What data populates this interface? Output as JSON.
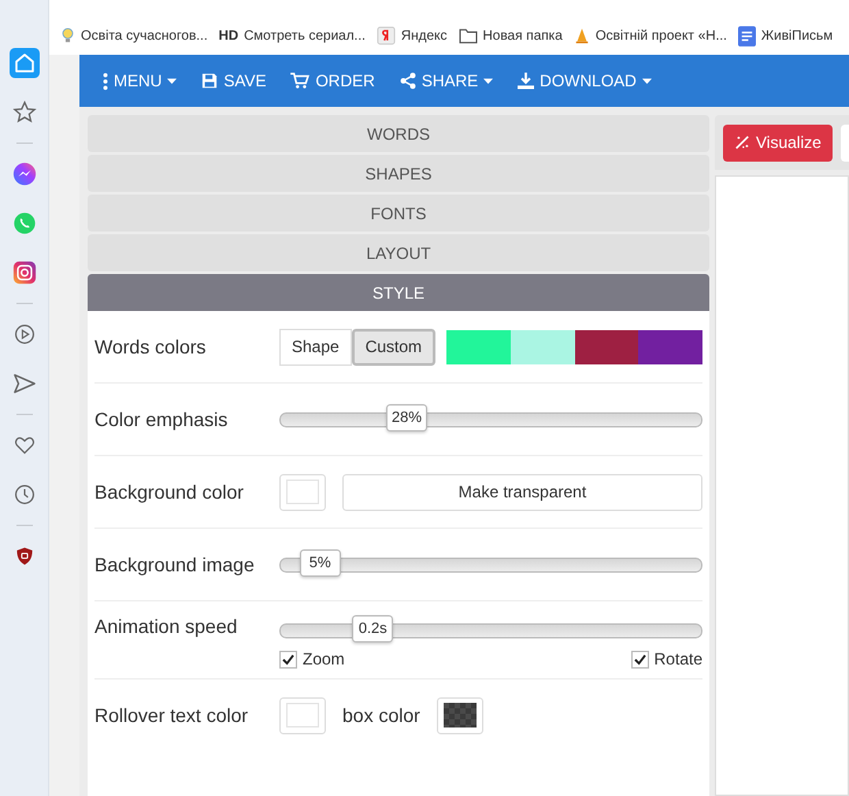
{
  "browser_sidebar": {
    "items": [
      {
        "kind": "home",
        "selected": true
      },
      {
        "kind": "star",
        "selected": false
      },
      {
        "kind": "messenger",
        "selected": false
      },
      {
        "kind": "whatsapp",
        "selected": false
      },
      {
        "kind": "instagram",
        "selected": false
      },
      {
        "kind": "play",
        "selected": false
      },
      {
        "kind": "send",
        "selected": false
      },
      {
        "kind": "heart",
        "selected": false
      },
      {
        "kind": "clock",
        "selected": false
      },
      {
        "kind": "shield",
        "selected": false
      }
    ]
  },
  "bookmarks": [
    {
      "kind": "bulb",
      "label": "Освіта сучасногов..."
    },
    {
      "kind": "text",
      "prefix": "HD",
      "label": "Смотреть сериал..."
    },
    {
      "kind": "yandex",
      "label": "Яндекс"
    },
    {
      "kind": "folder",
      "label": "Новая папка"
    },
    {
      "kind": "cone",
      "label": "Освітній проект «Н..."
    },
    {
      "kind": "doc",
      "label": "ЖивіПисьм"
    }
  ],
  "toolbar": [
    {
      "kind": "menu",
      "label": "MENU",
      "dropdown": true
    },
    {
      "kind": "save",
      "label": "SAVE",
      "dropdown": false
    },
    {
      "kind": "cart",
      "label": "ORDER",
      "dropdown": false
    },
    {
      "kind": "share",
      "label": "SHARE",
      "dropdown": true
    },
    {
      "kind": "download",
      "label": "DOWNLOAD",
      "dropdown": true
    }
  ],
  "sections": [
    {
      "label": "WORDS",
      "selected": false
    },
    {
      "label": "SHAPES",
      "selected": false
    },
    {
      "label": "FONTS",
      "selected": false
    },
    {
      "label": "LAYOUT",
      "selected": false
    },
    {
      "label": "STYLE",
      "selected": true
    }
  ],
  "style": {
    "words_colors": {
      "label": "Words colors",
      "options": [
        {
          "label": "Shape",
          "selected": false
        },
        {
          "label": "Custom",
          "selected": true
        }
      ],
      "palette": [
        {
          "color": "#22f59a"
        },
        {
          "color": "#aaf5e3"
        },
        {
          "color": "#9e2042"
        },
        {
          "color": "#7220a0"
        }
      ]
    },
    "color_emphasis": {
      "label": "Color emphasis",
      "level": 0.28,
      "reading": "28%"
    },
    "background_color": {
      "label": "Background color",
      "button": "Make transparent"
    },
    "background_image": {
      "label": "Background image",
      "level": 0.05,
      "reading": "5%"
    },
    "animation_speed": {
      "label": "Animation speed",
      "level": 0.19,
      "reading": "0.2s",
      "options": [
        {
          "label": "Zoom",
          "checked": true
        },
        {
          "label": "Rotate",
          "checked": true
        }
      ]
    },
    "rollover": {
      "label": "Rollover text color",
      "box_label": "box color"
    }
  },
  "visualize_button": "Visualize"
}
